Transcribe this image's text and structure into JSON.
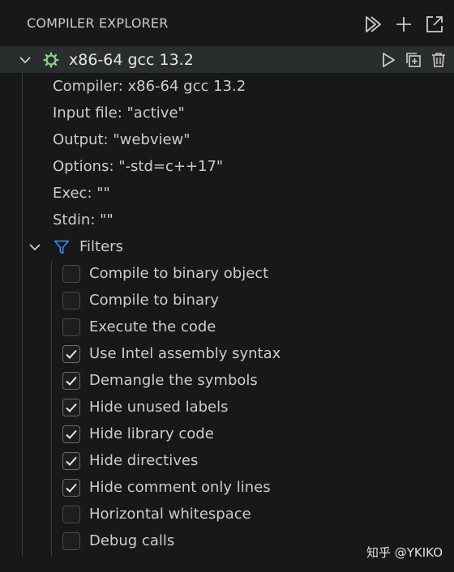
{
  "header": {
    "title": "COMPILER EXPLORER",
    "actions": [
      {
        "icon": "run-all-icon"
      },
      {
        "icon": "add-icon"
      },
      {
        "icon": "open-external-icon"
      }
    ]
  },
  "compiler": {
    "label": "x86-64 gcc 13.2",
    "icon_color": "#89d185",
    "properties": [
      "Compiler: x86-64 gcc 13.2",
      "Input file: \"active\"",
      "Output: \"webview\"",
      "Options: \"-std=c++17\"",
      "Exec: \"\"",
      "Stdin: \"\""
    ]
  },
  "filters": {
    "label": "Filters",
    "icon_color": "#3794ff",
    "items": [
      {
        "label": "Compile to binary object",
        "checked": false
      },
      {
        "label": "Compile to binary",
        "checked": false
      },
      {
        "label": "Execute the code",
        "checked": false
      },
      {
        "label": "Use Intel assembly syntax",
        "checked": true
      },
      {
        "label": "Demangle the symbols",
        "checked": true
      },
      {
        "label": "Hide unused labels",
        "checked": true
      },
      {
        "label": "Hide library code",
        "checked": true
      },
      {
        "label": "Hide directives",
        "checked": true
      },
      {
        "label": "Hide comment only lines",
        "checked": true
      },
      {
        "label": "Horizontal whitespace",
        "checked": false
      },
      {
        "label": "Debug calls",
        "checked": false
      }
    ]
  },
  "watermark": "知乎 @YKIKO"
}
